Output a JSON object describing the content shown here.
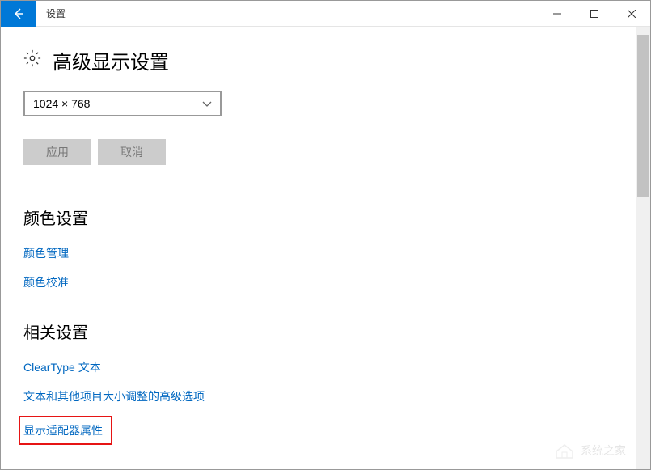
{
  "titlebar": {
    "title": "设置"
  },
  "page": {
    "heading": "高级显示设置"
  },
  "resolution": {
    "value": "1024 × 768"
  },
  "buttons": {
    "apply": "应用",
    "cancel": "取消"
  },
  "sections": {
    "color": {
      "header": "颜色设置",
      "links": {
        "management": "颜色管理",
        "calibration": "颜色校准"
      }
    },
    "related": {
      "header": "相关设置",
      "links": {
        "cleartype": "ClearType 文本",
        "text_scaling": "文本和其他项目大小调整的高级选项",
        "adapter": "显示适配器属性"
      }
    }
  },
  "watermark": {
    "text": "系统之家"
  }
}
